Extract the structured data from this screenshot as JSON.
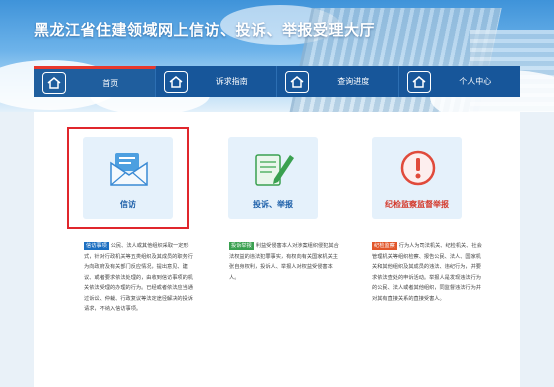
{
  "header": {
    "title": "黑龙江省住建领域网上信访、投诉、举报受理大厅"
  },
  "nav": {
    "items": [
      {
        "label": "首页",
        "icon": "home-icon",
        "active": true
      },
      {
        "label": "诉求指南",
        "icon": "home-icon",
        "active": false
      },
      {
        "label": "查询进度",
        "icon": "home-icon",
        "active": false
      },
      {
        "label": "个人中心",
        "icon": "home-icon",
        "active": false
      }
    ]
  },
  "cards": [
    {
      "label": "信访",
      "label_color": "#1b5ea8",
      "icon": "envelope-icon",
      "tag": "信访事项",
      "tag_color": "#1d6fc1",
      "desc": "公民、法人或其他组织采取一定形式，针对行政机关等五类组织及其成员的职务行为向政府及有关部门反应情况，提出意见、建议、或者要求依法处理的，由收到信访事项的机关依法受理的办理的行为。已经或者依法应当通过诉讼、仲裁、行政复议等法定途径解决的投诉请求，不纳入信访事项。"
    },
    {
      "label": "投诉、举报",
      "label_color": "#1b5ea8",
      "icon": "document-pen-icon",
      "tag": "投诉举报",
      "tag_color": "#3aa050",
      "desc": "利益受侵害本人对涉案组织侵犯其合法权益的违法犯罪事实，有权向有关国家机关主张自身权利，投诉人、举报人对权益受侵害本人。"
    },
    {
      "label": "纪检监察监督举报",
      "label_color": "#d4382a",
      "icon": "alert-icon",
      "tag": "纪检监察",
      "tag_color": "#e2572b",
      "desc": "行为人为司法机关、纪检机关、社会管理机关等组织检察、报告公民、法人、国家机关和其他组织及其成员的违法、违纪行为，并要求依法查处的申诉活动。举报人是发现违法行为的公民、法人或者其他组织，同监督违法行为并对其有直接关系的直接受害人。"
    }
  ],
  "colors": {
    "nav_bg": "#17569a",
    "active_marker": "#e8382c",
    "highlight_border": "#e0262c"
  }
}
